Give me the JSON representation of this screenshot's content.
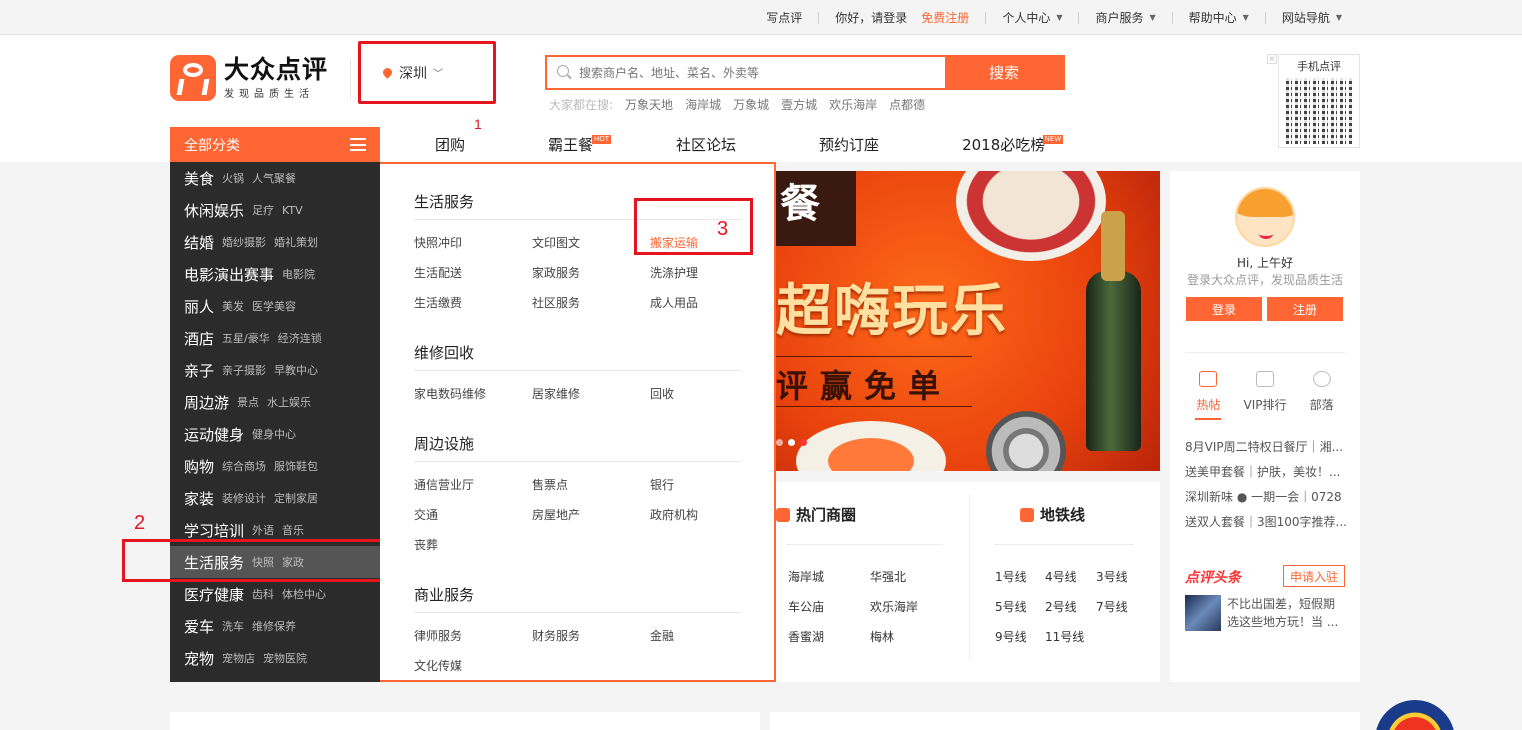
{
  "topbar": {
    "write_review": "写点评",
    "greeting": "你好，请登录",
    "register": "免费注册",
    "personal": "个人中心",
    "merchant": "商户服务",
    "help": "帮助中心",
    "sitenav": "网站导航"
  },
  "logo": {
    "title": "大众点评",
    "slogan": "发现品质生活"
  },
  "city": {
    "name": "深圳",
    "marker": "1"
  },
  "search": {
    "placeholder": "搜索商户名、地址、菜名、外卖等",
    "button": "搜索",
    "hot_label": "大家都在搜:",
    "hot": [
      "万象天地",
      "海岸城",
      "万象城",
      "壹方城",
      "欢乐海岸",
      "点都德"
    ]
  },
  "qr": {
    "title": "手机点评"
  },
  "nav": {
    "all": "全部分类",
    "items": [
      {
        "label": "团购",
        "tag": ""
      },
      {
        "label": "霸王餐",
        "tag": "HOT"
      },
      {
        "label": "社区论坛",
        "tag": ""
      },
      {
        "label": "预约订座",
        "tag": ""
      },
      {
        "label": "2018必吃榜",
        "tag": "NEW"
      }
    ]
  },
  "sidebar": [
    {
      "main": "美食",
      "subs": [
        "火锅",
        "人气聚餐"
      ]
    },
    {
      "main": "休闲娱乐",
      "subs": [
        "足疗",
        "KTV"
      ]
    },
    {
      "main": "结婚",
      "subs": [
        "婚纱摄影",
        "婚礼策划"
      ]
    },
    {
      "main": "电影演出赛事",
      "subs": [
        "电影院",
        ""
      ]
    },
    {
      "main": "丽人",
      "subs": [
        "美发",
        "医学美容"
      ]
    },
    {
      "main": "酒店",
      "subs": [
        "五星/豪华",
        "经济连锁"
      ]
    },
    {
      "main": "亲子",
      "subs": [
        "亲子摄影",
        "早教中心"
      ]
    },
    {
      "main": "周边游",
      "subs": [
        "景点",
        "水上娱乐"
      ]
    },
    {
      "main": "运动健身",
      "subs": [
        "健身中心",
        ""
      ]
    },
    {
      "main": "购物",
      "subs": [
        "综合商场",
        "服饰鞋包"
      ]
    },
    {
      "main": "家装",
      "subs": [
        "装修设计",
        "定制家居"
      ]
    },
    {
      "main": "学习培训",
      "subs": [
        "外语",
        "音乐"
      ]
    },
    {
      "main": "生活服务",
      "subs": [
        "快照",
        "家政"
      ]
    },
    {
      "main": "医疗健康",
      "subs": [
        "齿科",
        "体检中心"
      ]
    },
    {
      "main": "爱车",
      "subs": [
        "洗车",
        "维修保养"
      ]
    },
    {
      "main": "宠物",
      "subs": [
        "宠物店",
        "宠物医院"
      ]
    }
  ],
  "markers": {
    "m2": "2",
    "m3": "3"
  },
  "dropdown": [
    {
      "title": "生活服务",
      "items": [
        "快照冲印",
        "文印图文",
        "搬家运输",
        "生活配送",
        "家政服务",
        "洗涤护理",
        "生活缴费",
        "社区服务",
        "成人用品"
      ]
    },
    {
      "title": "维修回收",
      "items": [
        "家电数码维修",
        "居家维修",
        "回收"
      ]
    },
    {
      "title": "周边设施",
      "items": [
        "通信营业厅",
        "售票点",
        "银行",
        "交通",
        "房屋地产",
        "政府机构",
        "丧葬"
      ]
    },
    {
      "title": "商业服务",
      "items": [
        "律师服务",
        "财务服务",
        "金融",
        "文化传媒"
      ]
    }
  ],
  "banner": {
    "corner": "餐",
    "headline": "超嗨玩乐",
    "sub": "评赢免单"
  },
  "hot_area": {
    "title": "热门商圈",
    "items": [
      "海岸城",
      "华强北",
      "车公庙",
      "欢乐海岸",
      "香蜜湖",
      "梅林"
    ]
  },
  "metro": {
    "title": "地铁线",
    "items": [
      "1号线",
      "4号线",
      "3号线",
      "5号线",
      "2号线",
      "7号线",
      "9号线",
      "11号线"
    ]
  },
  "user": {
    "hi": "Hi,  上午好",
    "tagline": "登录大众点评，发现品质生活",
    "login": "登录",
    "register": "注册",
    "tabs": [
      "热帖",
      "VIP排行",
      "部落"
    ],
    "posts": [
      "8月VIP周二特权日餐厅｜湘...",
      "送美甲套餐｜护肤，美妆！...",
      "深圳新味 ● 一期一会｜0728",
      "送双人套餐｜3图100字推荐..."
    ],
    "headline_logo": "点评头条",
    "apply": "申请入驻",
    "news": "不比出国差，短假期选这些地方玩！当 ..."
  },
  "colors": {
    "accent": "#ff6633",
    "annotation": "#e6141e",
    "sidebar": "#2b2b2b"
  }
}
